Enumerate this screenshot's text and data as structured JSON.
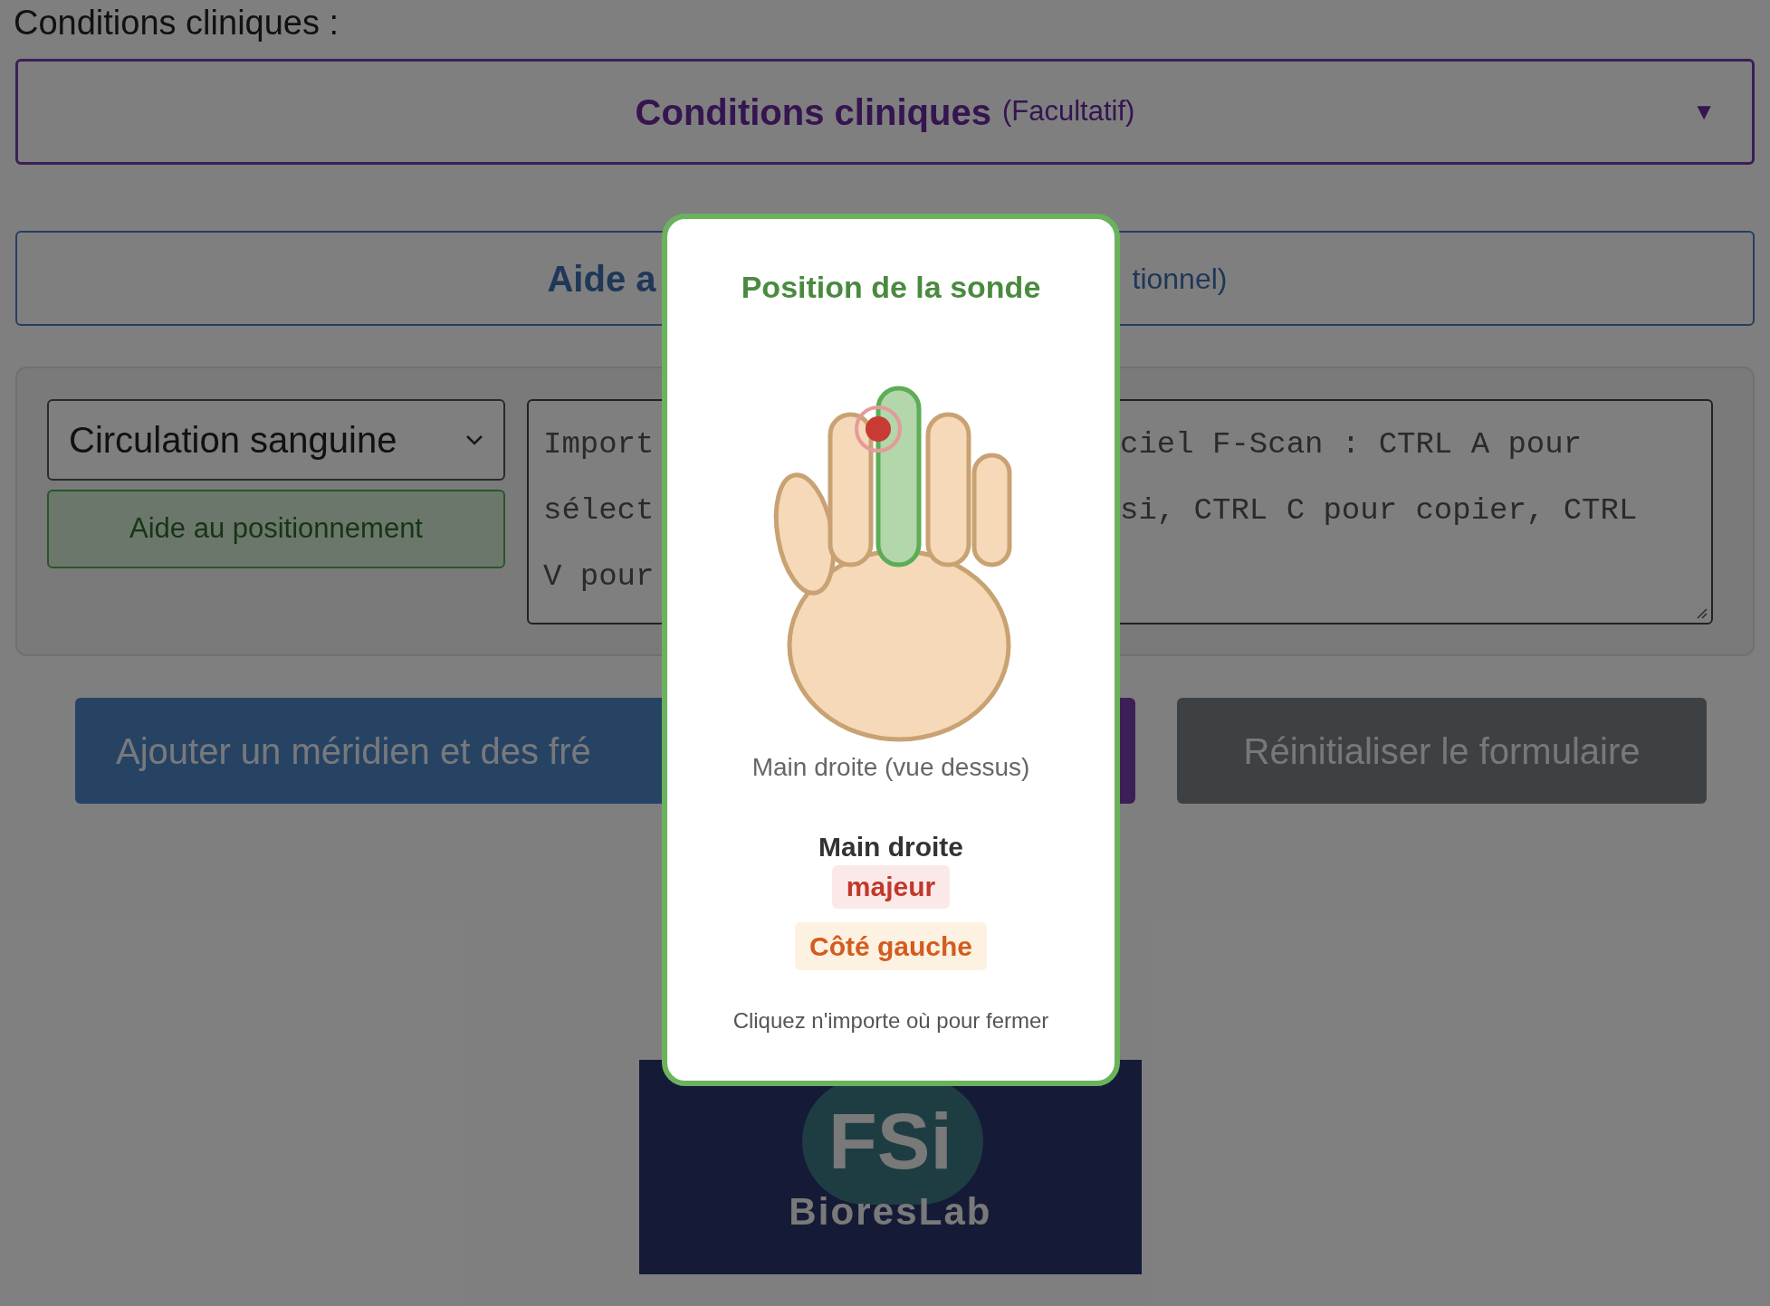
{
  "conditions_label": "Conditions cliniques :",
  "conditions_dropdown": {
    "title": "Conditions cliniques",
    "note": "(Facultatif)",
    "arrow": "▼"
  },
  "aide_panel": {
    "title_visible": "Aide a",
    "note_visible": "tionnel)"
  },
  "form_panel": {
    "select": "Circulation sanguine",
    "help_button": "Aide au positionnement",
    "textarea_left": [
      "Import",
      "sélect",
      "V pour"
    ],
    "textarea_right": [
      "ciel F-Scan : CTRL A pour",
      "si, CTRL C pour copier, CTRL"
    ]
  },
  "buttons": [
    {
      "kind": "primary",
      "label": "Ajouter un méridien et des fré"
    },
    {
      "kind": "accent"
    },
    {
      "kind": "secondary",
      "label": "Réinitialiser le formulaire"
    }
  ],
  "logo": {
    "mark": "FSi",
    "name": "BioresLab"
  },
  "modal": {
    "title": "Position de la sonde",
    "fingers": [
      {
        "selected": false
      },
      {
        "selected": true
      },
      {
        "selected": false
      },
      {
        "selected": false
      }
    ],
    "caption": "Main droite (vue dessus)",
    "hand": "Main droite",
    "finger": "majeur",
    "side": "Côté gauche",
    "footer": "Cliquez n'importe où pour fermer"
  }
}
